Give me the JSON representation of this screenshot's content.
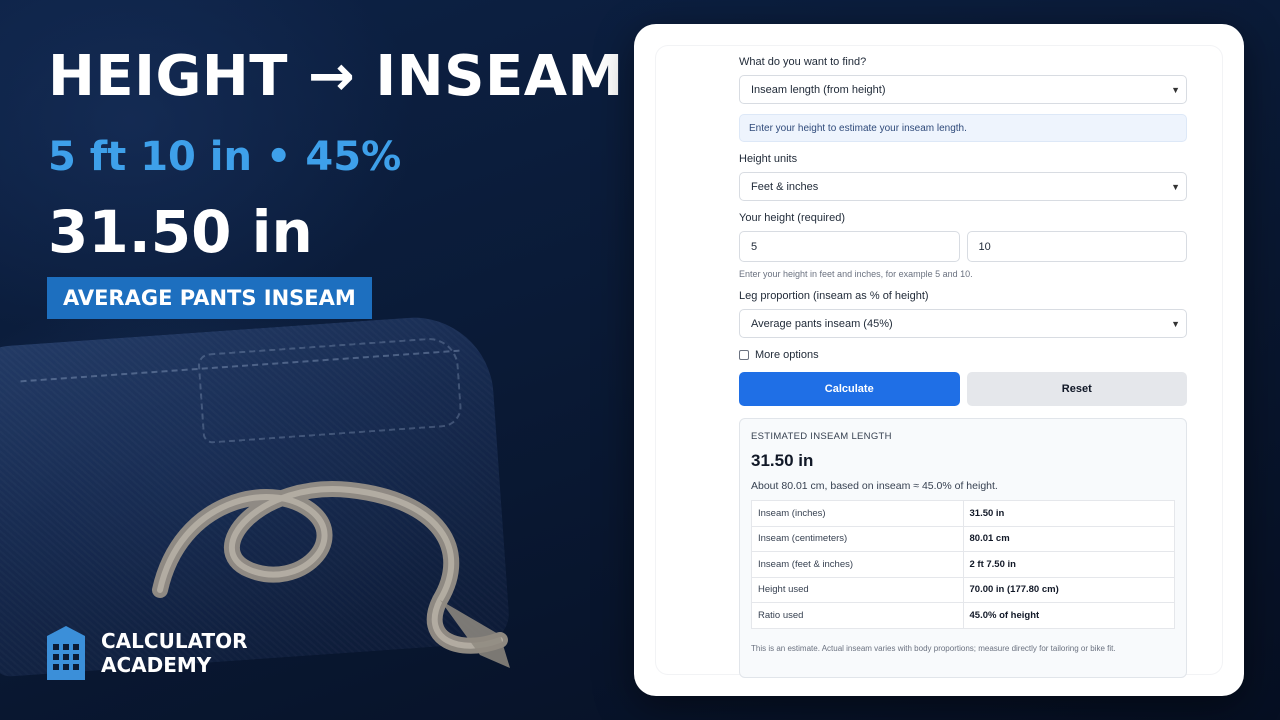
{
  "hero": {
    "headline": "HEIGHT → INSEAM",
    "subline": "5 ft 10 in • 45%",
    "result": "31.50 in",
    "badge": "AVERAGE PANTS INSEAM"
  },
  "brand": {
    "line1": "CALCULATOR",
    "line2": "ACADEMY"
  },
  "form": {
    "find_label": "What do you want to find?",
    "find_value": "Inseam length (from height)",
    "info_text": "Enter your height to estimate your inseam length.",
    "units_label": "Height units",
    "units_value": "Feet & inches",
    "height_label": "Your height (required)",
    "height_feet": "5",
    "height_inches": "10",
    "height_hint": "Enter your height in feet and inches, for example 5 and 10.",
    "proportion_label": "Leg proportion (inseam as % of height)",
    "proportion_value": "Average pants inseam (45%)",
    "more_options_label": "More options",
    "calculate_label": "Calculate",
    "reset_label": "Reset"
  },
  "results": {
    "title": "ESTIMATED INSEAM LENGTH",
    "value": "31.50 in",
    "subtext": "About 80.01 cm, based on inseam ≈ 45.0% of height.",
    "rows": [
      {
        "label": "Inseam (inches)",
        "value": "31.50 in"
      },
      {
        "label": "Inseam (centimeters)",
        "value": "80.01 cm"
      },
      {
        "label": "Inseam (feet & inches)",
        "value": "2 ft 7.50 in"
      },
      {
        "label": "Height used",
        "value": "70.00 in (177.80 cm)"
      },
      {
        "label": "Ratio used",
        "value": "45.0% of height"
      }
    ],
    "note": "This is an estimate. Actual inseam varies with body proportions; measure directly for tailoring or bike fit."
  },
  "colors": {
    "accent": "#3ea0ea",
    "badge": "#1d6fbf",
    "primary_button": "#1f6fe6"
  }
}
